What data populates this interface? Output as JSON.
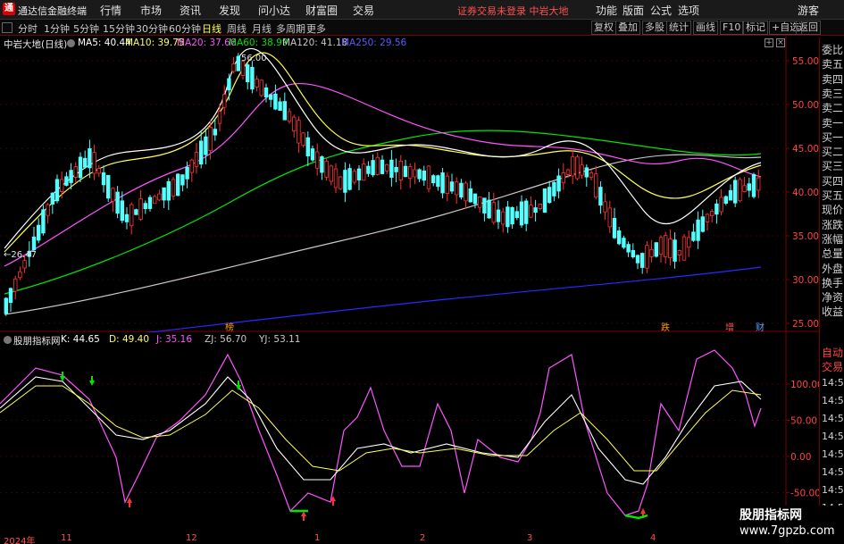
{
  "titlebar": {
    "app_name": "通达信金融终端",
    "menus": [
      "行情",
      "市场",
      "资讯",
      "发现",
      "问小达",
      "财富圈",
      "交易"
    ],
    "status": "证券交易未登录  中岩大地",
    "right_menus": [
      "功能",
      "版面",
      "公式",
      "选项"
    ],
    "guest": "游客"
  },
  "toolbar": {
    "periods": [
      "分时",
      "1分钟",
      "5分钟",
      "15分钟",
      "30分钟",
      "60分钟",
      "日线",
      "周线",
      "月线",
      "多周期",
      "更多"
    ],
    "active_period": "日线",
    "right_buttons": [
      "复权",
      "叠加",
      "多股",
      "统计",
      "画线",
      "F10",
      "标记",
      "+自选",
      "返回"
    ]
  },
  "chart_legend": {
    "stock": "中岩大地(日线)",
    "ma5": "MA5: 40.44",
    "ma10": "MA10: 39.75",
    "ma20": "MA20: 37.66",
    "ma60": "MA60: 38.99",
    "ma120": "MA120: 41.18",
    "ma250": "MA250: 29.56",
    "colors": {
      "ma5": "#ffffff",
      "ma10": "#ffff54",
      "ma20": "#ff54ff",
      "ma60": "#00e600",
      "ma120": "#c8c8c8",
      "ma250": "#2a2aff"
    }
  },
  "price_axis": [
    "55.00",
    "50.00",
    "45.00",
    "40.00",
    "35.00",
    "30.00",
    "25.00",
    "20.00"
  ],
  "price_annotations": {
    "high": "56.00",
    "low": "26.47"
  },
  "event_markers": [
    {
      "label": "榜",
      "color": "#ff9900"
    },
    {
      "label": "跌",
      "color": "#ff9900"
    },
    {
      "label": "增",
      "color": "#ff5050"
    },
    {
      "label": "财",
      "color": "#5aa0ff"
    }
  ],
  "kdj_legend": {
    "name": "股朋指标网",
    "k": "K: 44.65",
    "d": "D: 49.40",
    "j": "J: 35.16",
    "zj": "ZJ: 56.70",
    "yj": "YJ: 53.11"
  },
  "kdj_axis": [
    "100.00",
    "50.00",
    "0.00",
    "-50.00"
  ],
  "right_panel": {
    "order_labels": [
      "委比",
      "卖五",
      "卖四",
      "卖三",
      "卖二",
      "卖一",
      "买一",
      "买二",
      "买三",
      "买四",
      "买五",
      "现价",
      "涨跌",
      "涨幅",
      "总量",
      "外盘",
      "换手",
      "净资",
      "收益"
    ],
    "tabs": [
      "自动",
      "交易"
    ],
    "times": [
      "14:56",
      "14:56",
      "14:56",
      "14:56",
      "14:56",
      "14:56",
      "14:56",
      "14:56"
    ]
  },
  "time_axis": [
    "2024年",
    "11",
    "12",
    "1",
    "2",
    "3",
    "4"
  ],
  "watermark": {
    "line1": "股朋指标网",
    "line2": "www.7gpzb.com"
  }
}
